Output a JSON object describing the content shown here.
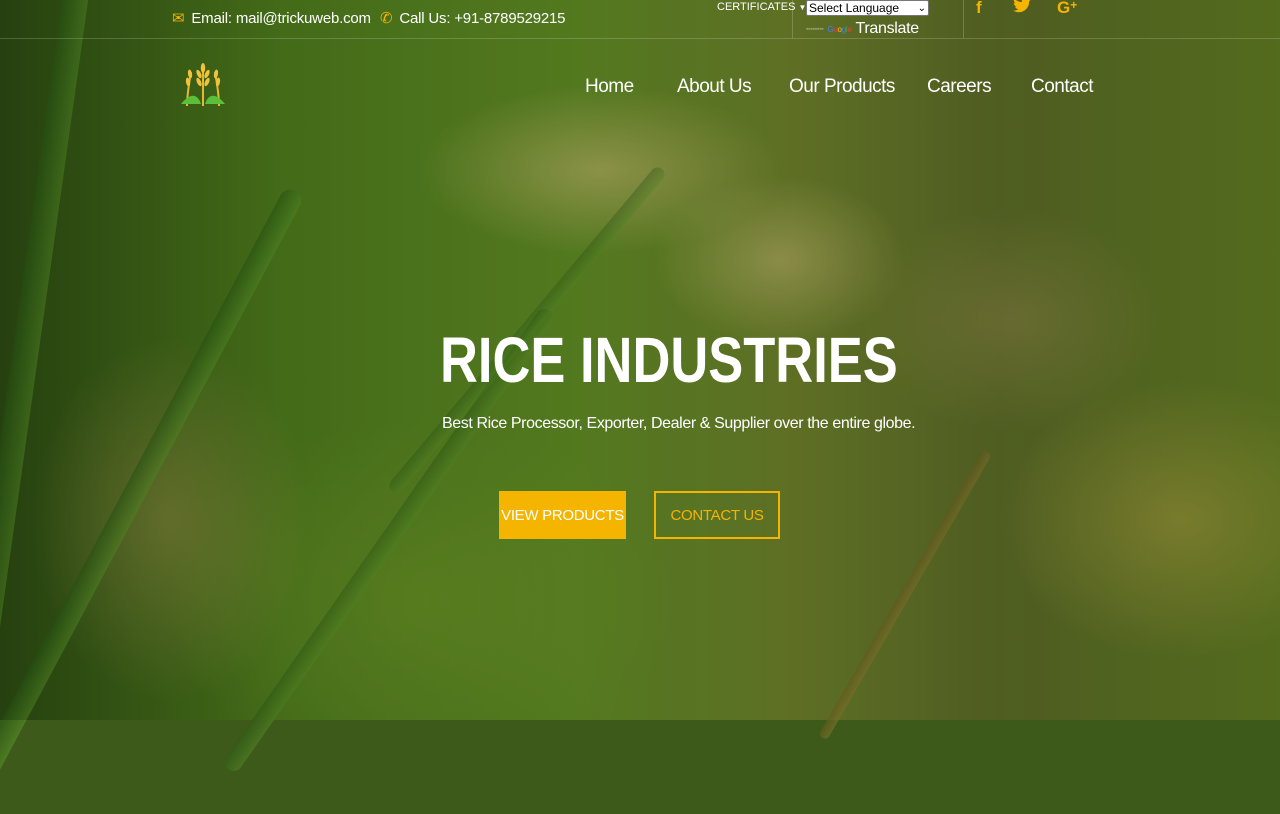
{
  "colors": {
    "accent": "#f5b400",
    "text": "#ffffff",
    "field_green": "#4d7a1c"
  },
  "topbar": {
    "email": {
      "icon": "envelope-icon",
      "text": "Email: mail@trickuweb.com"
    },
    "phone": {
      "icon": "phone-icon",
      "text": "Call Us: +91-8789529215"
    },
    "certificates_label": "CERTIFICATES",
    "language_select": {
      "selected": "Select Language"
    },
    "translate": {
      "google_text": "Google",
      "label": "Translate"
    },
    "social": [
      {
        "name": "facebook-icon",
        "glyph": "f"
      },
      {
        "name": "twitter-icon",
        "glyph": "🐦"
      },
      {
        "name": "google-plus-icon",
        "glyph": "G+"
      }
    ]
  },
  "nav": {
    "logo": "wheat-logo-icon",
    "links": [
      {
        "label": "Home"
      },
      {
        "label": "About Us"
      },
      {
        "label": "Our Products"
      },
      {
        "label": "Careers"
      },
      {
        "label": "Contact"
      }
    ]
  },
  "hero": {
    "title": "RICE INDUSTRIES",
    "subtitle": "Best Rice Processor, Exporter, Dealer & Supplier over the entire globe.",
    "buttons": [
      {
        "label": "VIEW PRODUCTS"
      },
      {
        "label": "CONTACT US"
      }
    ]
  }
}
